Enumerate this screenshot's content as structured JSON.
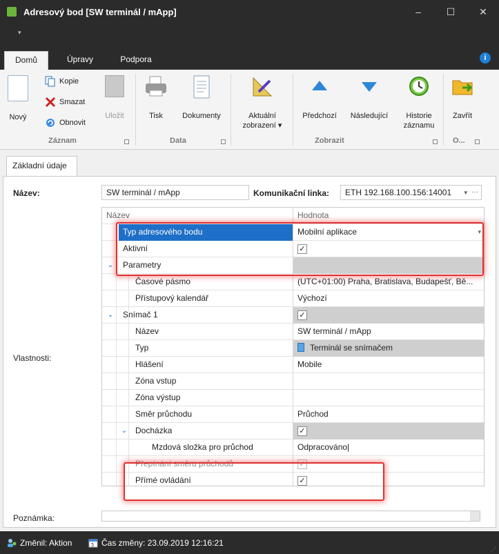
{
  "window": {
    "title": "Adresový bod [SW terminál / mApp]",
    "minimize": "‒",
    "maximize": "☐",
    "close": "✕",
    "qat_arrow": "▾"
  },
  "ribbon_tabs": [
    "Domů",
    "Úpravy",
    "Podpora"
  ],
  "ribbon": {
    "new_label": "Nový",
    "copy_label": "Kopie",
    "delete_label": "Smazat",
    "refresh_label": "Obnovit",
    "save_label": "Uložit",
    "print_label": "Tisk",
    "documents_label": "Dokumenty",
    "current_view_label_1": "Aktuální",
    "current_view_label_2": "zobrazení ▾",
    "previous_label": "Předchozí",
    "next_label": "Následující",
    "history_label_1": "Historie",
    "history_label_2": "záznamu",
    "close_label": "Zavřít",
    "group_record": "Záznam",
    "group_data": "Data",
    "group_view": "Zobrazit",
    "group_other": "O..."
  },
  "page_tab": "Základní údaje",
  "form": {
    "name_label": "Název:",
    "name_value": "SW terminál / mApp",
    "comm_label": "Komunikační linka:",
    "comm_value": "ETH 192.168.100.156:14001",
    "props_label": "Vlastnosti:",
    "note_label": "Poznámka:"
  },
  "grid": {
    "col_name": "Název",
    "col_value": "Hodnota",
    "rows": [
      {
        "name": "Typ adresového bodu",
        "value": "Mobilní aplikace"
      },
      {
        "name": "Aktivní",
        "value": "✓"
      },
      {
        "name": "Parametry",
        "value": ""
      },
      {
        "name": "Časové pásmo",
        "value": "(UTC+01:00) Praha, Bratislava, Budapešť, Bě..."
      },
      {
        "name": "Přístupový kalendář",
        "value": "Výchozí"
      },
      {
        "name": "Snímač 1",
        "value": "✓"
      },
      {
        "name": "Název",
        "value": "SW terminál / mApp"
      },
      {
        "name": "Typ",
        "value": "Terminál se snímačem"
      },
      {
        "name": "Hlášení",
        "value": "Mobile"
      },
      {
        "name": "Zóna vstup",
        "value": ""
      },
      {
        "name": "Zóna výstup",
        "value": ""
      },
      {
        "name": "Směr průchodu",
        "value": "Průchod"
      },
      {
        "name": "Docházka",
        "value": "✓"
      },
      {
        "name": "Mzdová složka pro průchod",
        "value": "Odpracováno|"
      },
      {
        "name": "Přepínání směru průchodů",
        "value": "✓"
      },
      {
        "name": "Přímé ovládání",
        "value": "✓"
      }
    ]
  },
  "status": {
    "changed_by": "Změnil: Aktion",
    "change_time": "Čas změny: 23.09.2019 12:16:21"
  },
  "colors": {
    "dark": "#2b2b2b",
    "selection": "#1e6fc8",
    "highlight": "#e03030"
  }
}
